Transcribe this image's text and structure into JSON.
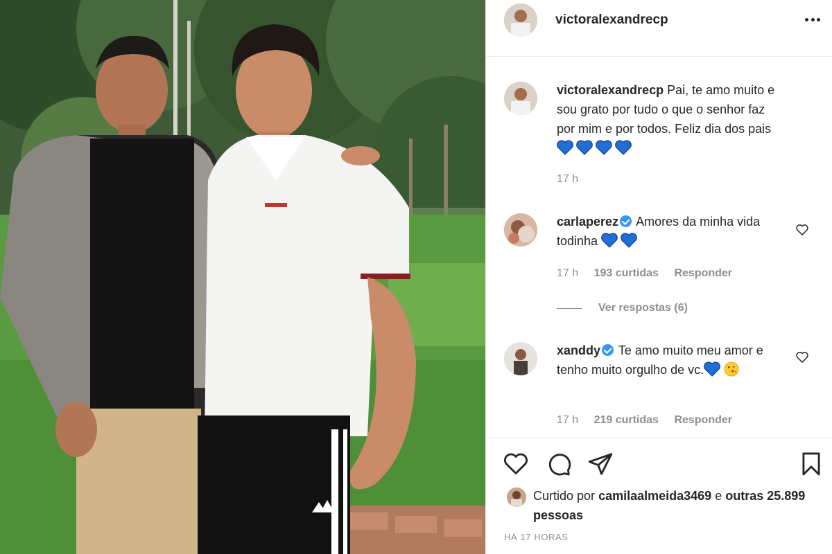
{
  "post": {
    "author": "victoralexandrecp",
    "more_icon": "more-horizontal-icon"
  },
  "caption": {
    "user": "victoralexandrecp",
    "text": "Pai, te amo muito e sou grato por tudo o que o senhor faz por mim e por todos. Feliz dia dos pais",
    "emoji_count": 4,
    "time": "17 h"
  },
  "comments": [
    {
      "user": "carlaperez",
      "verified": true,
      "text": "Amores da minha vida todinha",
      "emoji": "💙💙",
      "time": "17 h",
      "likes": "193 curtidas",
      "reply_label": "Responder"
    },
    {
      "user": "xanddy",
      "verified": true,
      "text": "Te amo muito meu amor e tenho muito orgulho de vc.",
      "emoji": "💙😘",
      "time": "17 h",
      "likes": "219 curtidas",
      "reply_label": "Responder"
    }
  ],
  "view_replies": "Ver respostas (6)",
  "likes": {
    "prefix": "Curtido por",
    "user": "camilaalmeida3469",
    "conj": "e",
    "others": "outras 25.899 pessoas"
  },
  "posted_ago": "HÁ 17 HORAS",
  "colors": {
    "accent_blue": "#3897f0",
    "text": "#262626",
    "muted": "#8e8e8e",
    "heart_blue": "#1f6fd6"
  }
}
